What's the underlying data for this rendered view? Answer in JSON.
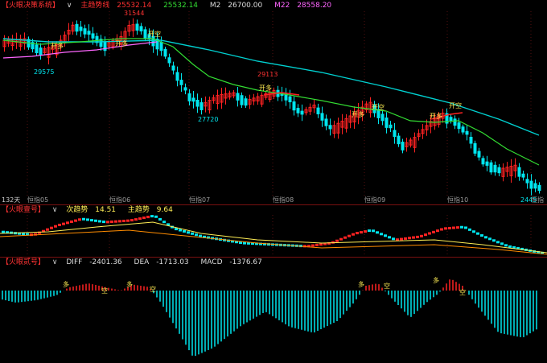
{
  "panel1": {
    "title": "【火眼决策系统】",
    "dropdown": "∨",
    "items": [
      {
        "label": "主趋势线",
        "value": "25532.14",
        "color": "#ff3030"
      },
      {
        "label": "",
        "value": "25532.14",
        "color": "#33dd33"
      },
      {
        "label": "M2",
        "value": "26700.00",
        "color": "#dddddd"
      },
      {
        "label": "M22",
        "value": "28558.20",
        "color": "#ff66ff"
      }
    ],
    "price_labels": [
      "31544",
      "29575",
      "29113",
      "27720",
      "2445"
    ],
    "signals": {
      "kai_duo": "开多",
      "kai_kong": "开空"
    },
    "period_label": "132天",
    "x_labels": [
      "恒指05",
      "恒指06",
      "恒指07",
      "恒指08",
      "恒指09",
      "恒指10",
      "恒指"
    ],
    "colors": {
      "up": "#ff2222",
      "down": "#00e5ee",
      "ma_short": "#33dd33",
      "ma_long": "#00d0d0",
      "trend": "#ff66ff"
    }
  },
  "panel2": {
    "title": "【火眼壹号】",
    "dropdown": "∨",
    "items": [
      {
        "label": "次趋势",
        "value": "14.51",
        "color": "#ffee55"
      },
      {
        "label": "主趋势",
        "value": "9.64",
        "color": "#ffee55"
      }
    ]
  },
  "panel3": {
    "title": "【火眼贰号】",
    "dropdown": "∨",
    "items": [
      {
        "label": "DIFF",
        "value": "-2401.36",
        "color": "#dddddd"
      },
      {
        "label": "DEA",
        "value": "-1713.03",
        "color": "#dddddd"
      },
      {
        "label": "MACD",
        "value": "-1376.67",
        "color": "#dddddd"
      }
    ],
    "signals": {
      "duo": "多",
      "kong": "空"
    }
  }
}
